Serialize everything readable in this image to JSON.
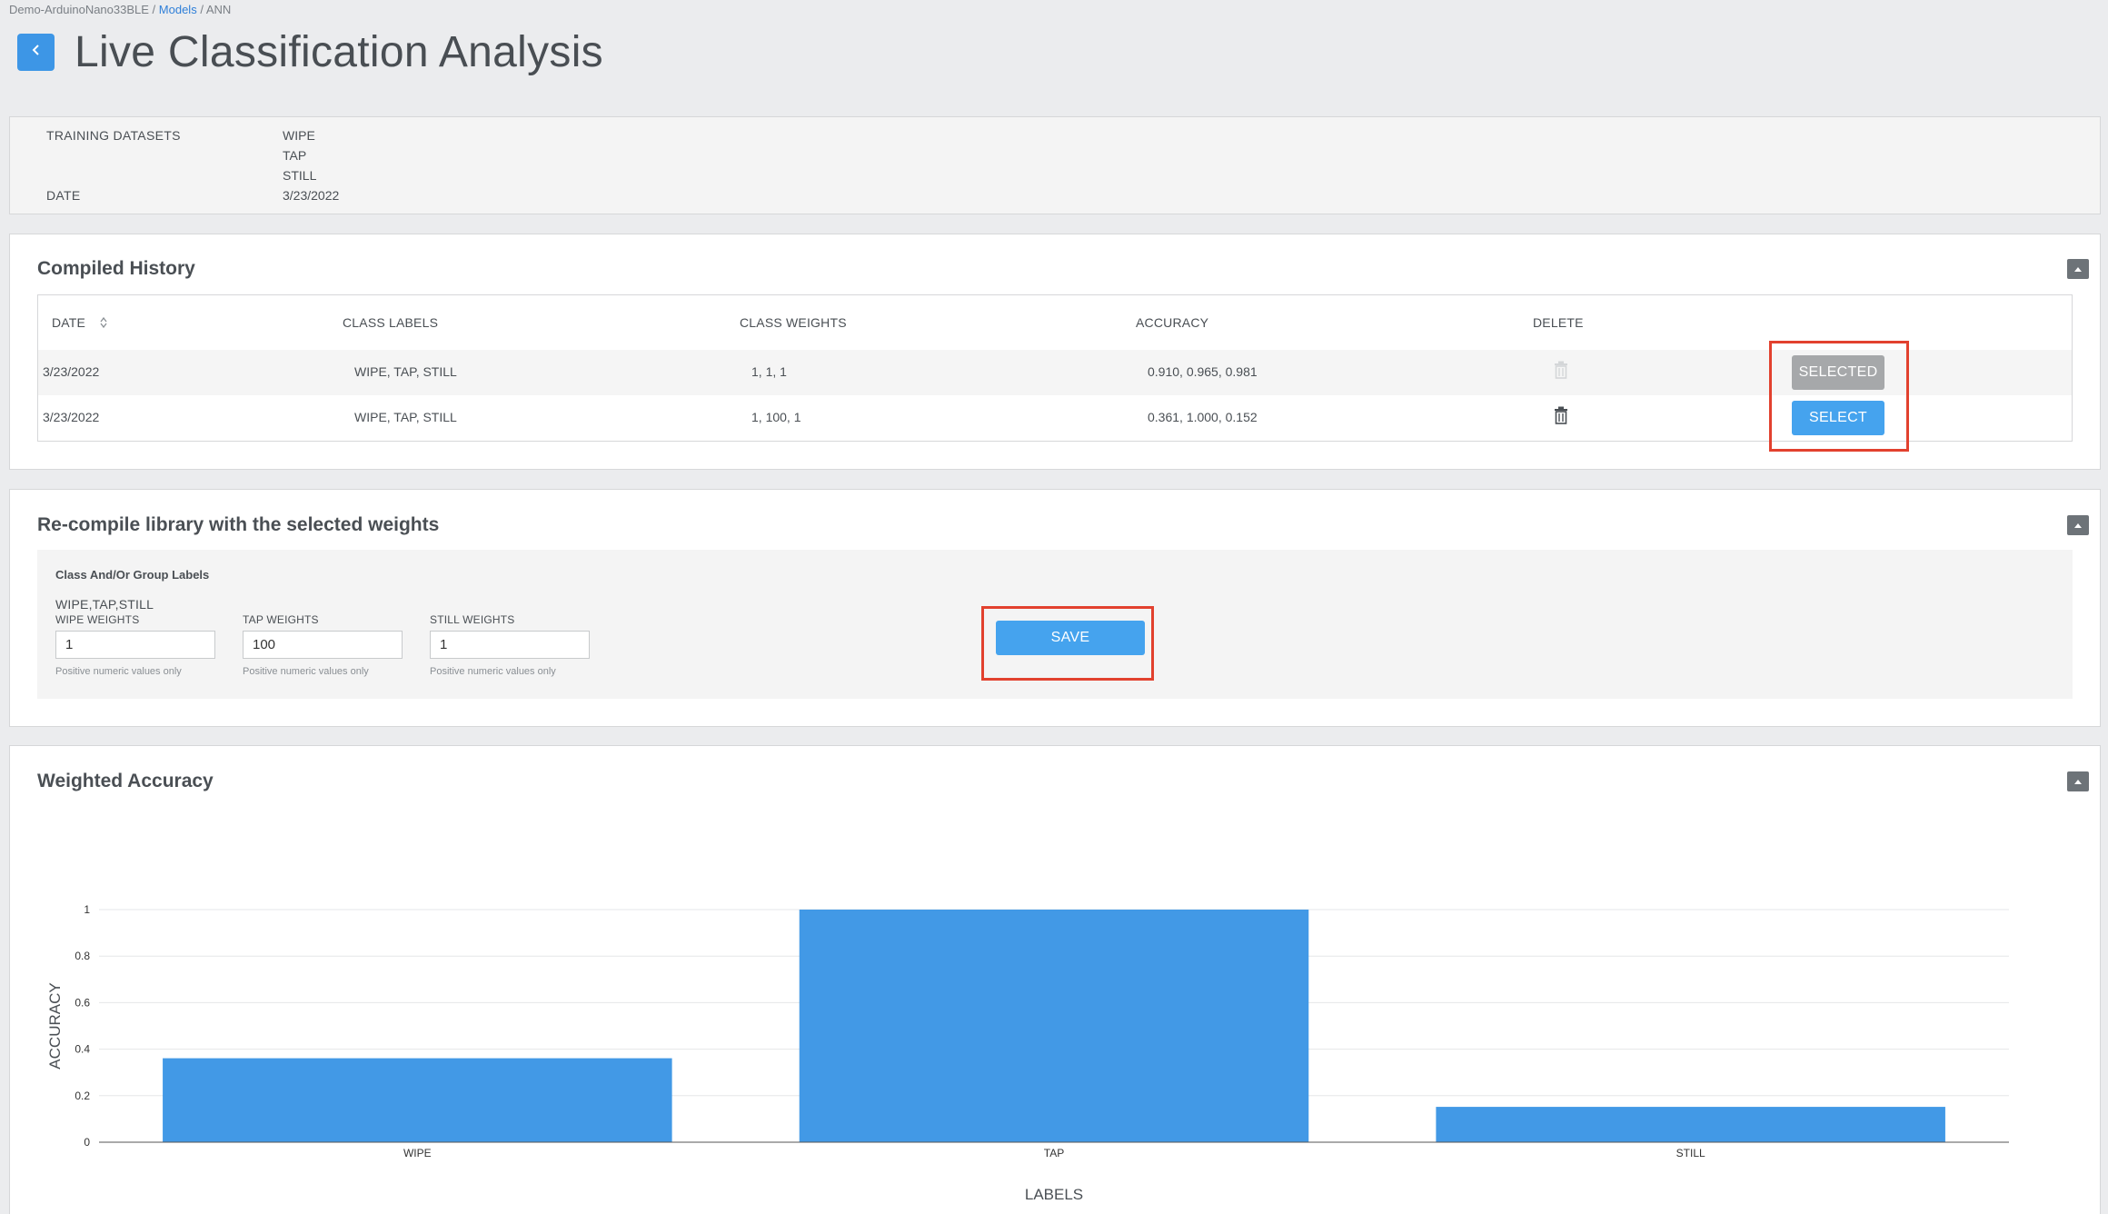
{
  "breadcrumb": {
    "project": "Demo-ArduinoNano33BLE",
    "sep1": " / ",
    "models": "Models",
    "sep2": " / ",
    "model": "ANN"
  },
  "header": {
    "title": "Live Classification Analysis",
    "back_icon": "chevron-left-icon"
  },
  "info": {
    "training_label": "TRAINING DATASETS",
    "training_values": [
      "WIPE",
      "TAP",
      "STILL"
    ],
    "date_label": "DATE",
    "date_value": "3/23/2022"
  },
  "history": {
    "title": "Compiled History",
    "columns": {
      "date": "DATE",
      "labels": "CLASS LABELS",
      "weights": "CLASS WEIGHTS",
      "accuracy": "ACCURACY",
      "delete": "DELETE"
    },
    "rows": [
      {
        "date": "3/23/2022",
        "labels": "WIPE, TAP, STILL",
        "weights": "1, 1, 1",
        "accuracy": "0.910, 0.965, 0.981",
        "action": "SELECTED"
      },
      {
        "date": "3/23/2022",
        "labels": "WIPE, TAP, STILL",
        "weights": "1, 100, 1",
        "accuracy": "0.361, 1.000, 0.152",
        "action": "SELECT"
      }
    ]
  },
  "recompile": {
    "title": "Re-compile library with the selected weights",
    "group_label": "Class And/Or Group Labels",
    "classes_text": "WIPE,TAP,STILL",
    "fields": [
      {
        "label": "WIPE WEIGHTS",
        "value": "1",
        "hint": "Positive numeric values only"
      },
      {
        "label": "TAP WEIGHTS",
        "value": "100",
        "hint": "Positive numeric values only"
      },
      {
        "label": "STILL WEIGHTS",
        "value": "1",
        "hint": "Positive numeric values only"
      }
    ],
    "save_label": "SAVE"
  },
  "accuracy_card": {
    "title": "Weighted Accuracy"
  },
  "colors": {
    "accent": "#45a3ee",
    "bar": "#4299e6",
    "highlight": "#e2412e",
    "selected_btn": "#a6a8aa"
  },
  "chart_data": {
    "type": "bar",
    "categories": [
      "WIPE",
      "TAP",
      "STILL"
    ],
    "values": [
      0.361,
      1.0,
      0.152
    ],
    "xlabel": "LABELS",
    "ylabel": "ACCURACY",
    "ylim": [
      0,
      1
    ],
    "yticks": [
      0,
      0.2,
      0.4,
      0.6,
      0.8,
      1
    ],
    "ytick_labels": [
      "0",
      "0.2",
      "0.4",
      "0.6",
      "0.8",
      "1"
    ],
    "grid": true
  }
}
